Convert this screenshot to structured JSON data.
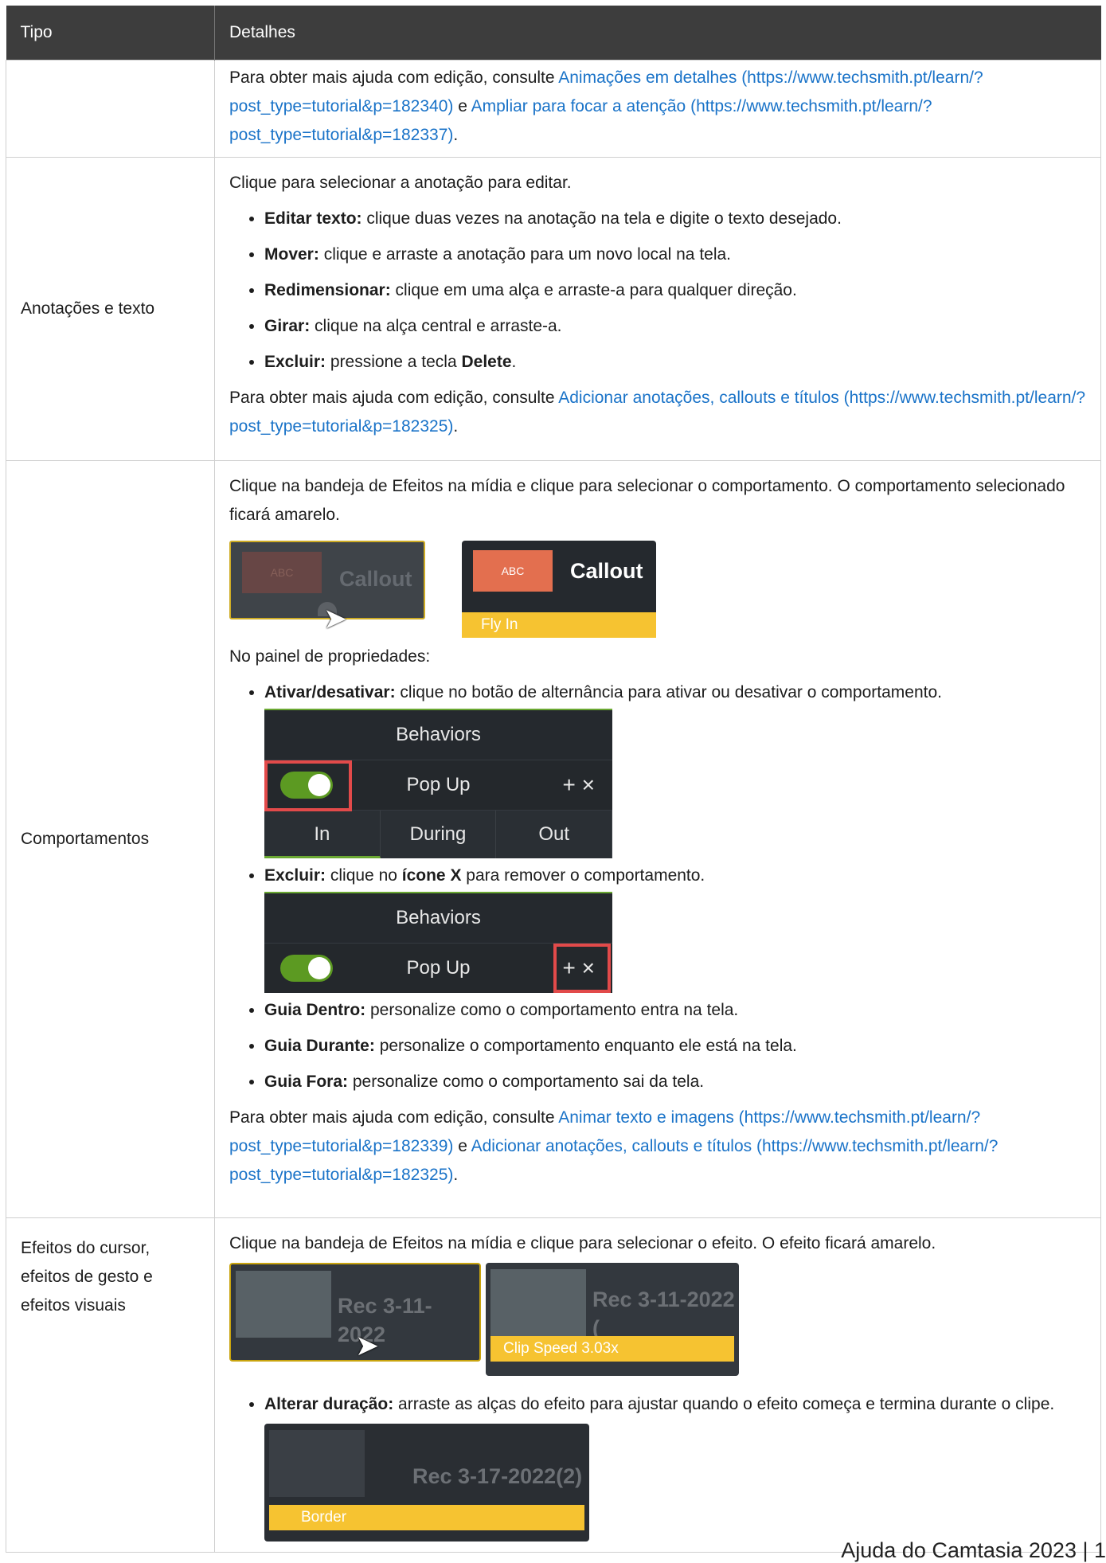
{
  "table": {
    "col_type": "Tipo",
    "col_details": "Detalhes"
  },
  "row0": {
    "text_prefix": "Para obter mais ajuda com edição, consulte ",
    "link1": "Animações em detalhes (https://www.techsmith.pt/learn/?post_type=tutorial&p=182340)",
    "mid": " e ",
    "link2": "Ampliar para focar a atenção (https://www.techsmith.pt/learn/?post_type=tutorial&p=182337)",
    "end": "."
  },
  "row1": {
    "type": "Anotações e texto",
    "intro": "Clique para selecionar a anotação para editar.",
    "items": [
      {
        "bold": "Editar texto:",
        "text": " clique duas vezes na anotação na tela e digite o texto desejado."
      },
      {
        "bold": "Mover:",
        "text": " clique e arraste a anotação para um novo local na tela."
      },
      {
        "bold": "Redimensionar:",
        "text": " clique em uma alça e arraste-a para qualquer direção."
      },
      {
        "bold": "Girar:",
        "text": " clique na alça central e arraste-a."
      },
      {
        "bold": "Excluir:",
        "text": " pressione a tecla ",
        "bold2": "Delete",
        "end": "."
      }
    ],
    "more_prefix": "Para obter mais ajuda com edição, consulte ",
    "more_link": "Adicionar anotações, callouts e títulos (https://www.techsmith.pt/learn/?post_type=tutorial&p=182325)",
    "more_end": "."
  },
  "row2": {
    "type": "Comportamentos",
    "intro": "Clique na bandeja de Efeitos na mídia e clique para selecionar o comportamento. O comportamento selecionado ficará amarelo.",
    "thumb": {
      "abc": "ABC",
      "title": "Callout",
      "bar": "Fly In"
    },
    "panel_intro": "No painel de propriedades:",
    "toggle_item": {
      "bold": "Ativar/desativar:",
      "text": " clique no botão de alternância para ativar ou desativar o comportamento."
    },
    "delete_item": {
      "bold": "Excluir:",
      "text": " clique no ",
      "bold2": "ícone X",
      "end": " para remover o comportamento."
    },
    "panel": {
      "header": "Behaviors",
      "name": "Pop Up",
      "plus": "+",
      "close": "×",
      "tabs": [
        "In",
        "During",
        "Out"
      ]
    },
    "more_items": [
      {
        "bold": "Guia Dentro:",
        "text": " personalize como o comportamento entra na tela."
      },
      {
        "bold": "Guia Durante:",
        "text": " personalize o comportamento enquanto ele está na tela."
      },
      {
        "bold": "Guia Fora:",
        "text": " personalize como o comportamento sai da tela."
      }
    ],
    "more_prefix": "Para obter mais ajuda com edição, consulte ",
    "link1": "Animar texto e imagens (https://www.techsmith.pt/learn/?post_type=tutorial&p=182339)",
    "mid": " e ",
    "link2": "Adicionar anotações, callouts e títulos (https://www.techsmith.pt/learn/?post_type=tutorial&p=182325)",
    "end": "."
  },
  "row3": {
    "type": "Efeitos do cursor, efeitos de gesto e efeitos visuais",
    "intro": "Clique na bandeja de Efeitos na mídia e clique para selecionar o efeito. O efeito ficará amarelo.",
    "thumb1": "Rec 3-11-2022",
    "thumb2": "Rec 3-11-2022 (",
    "thumb2_bar": "Clip Speed 3.03x",
    "item": {
      "bold": "Alterar duração:",
      "text": " arraste as alças do efeito para ajustar quando o efeito começa e termina durante o clipe."
    },
    "thumb3": "Rec 3-17-2022(2)",
    "thumb3_bar": "Border"
  },
  "footer": "Ajuda do Camtasia 2023 | 1"
}
